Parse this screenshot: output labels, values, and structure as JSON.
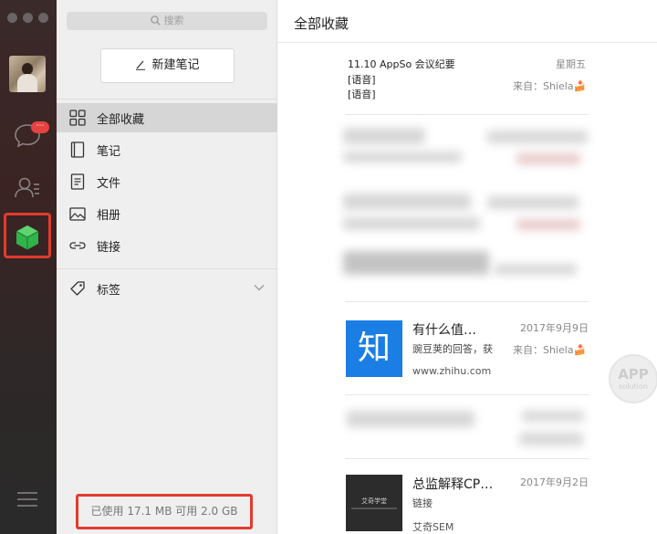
{
  "rail": {
    "chat_badge": "⋯"
  },
  "sidebar": {
    "search_placeholder": "搜索",
    "new_note_label": "新建笔记",
    "nav_items": [
      {
        "label": "全部收藏",
        "icon": "grid-icon"
      },
      {
        "label": "笔记",
        "icon": "notebook-icon"
      },
      {
        "label": "文件",
        "icon": "file-icon"
      },
      {
        "label": "相册",
        "icon": "image-icon"
      },
      {
        "label": "链接",
        "icon": "link-icon"
      }
    ],
    "tags_label": "标签",
    "storage_text": "已使用 17.1 MB 可用 2.0 GB"
  },
  "main": {
    "title": "全部收藏",
    "items": [
      {
        "title": "11.10 AppSo 会议纪要",
        "line2": "[语音]",
        "line3": "[语音]",
        "date": "星期五",
        "from": "来自：Shiela🍰"
      },
      {
        "title": "有什么值…",
        "line2": "豌豆荚的回答，获",
        "line3": "www.zhihu.com",
        "date": "2017年9月9日",
        "from": "来自：Shiela🍰",
        "thumb_text": "知"
      },
      {
        "title": "总监解释CP…",
        "line2": "链接",
        "line3": "艾奇SEM",
        "date": "2017年9月2日",
        "thumb_text": "艾奇学堂"
      }
    ]
  },
  "watermark": {
    "line1": "APP",
    "line2": "solution"
  },
  "colors": {
    "accent_red": "#e23b2e",
    "fav_green": "#2fb54a",
    "zhihu_blue": "#1a7ee4",
    "badge_red": "#e64340"
  }
}
